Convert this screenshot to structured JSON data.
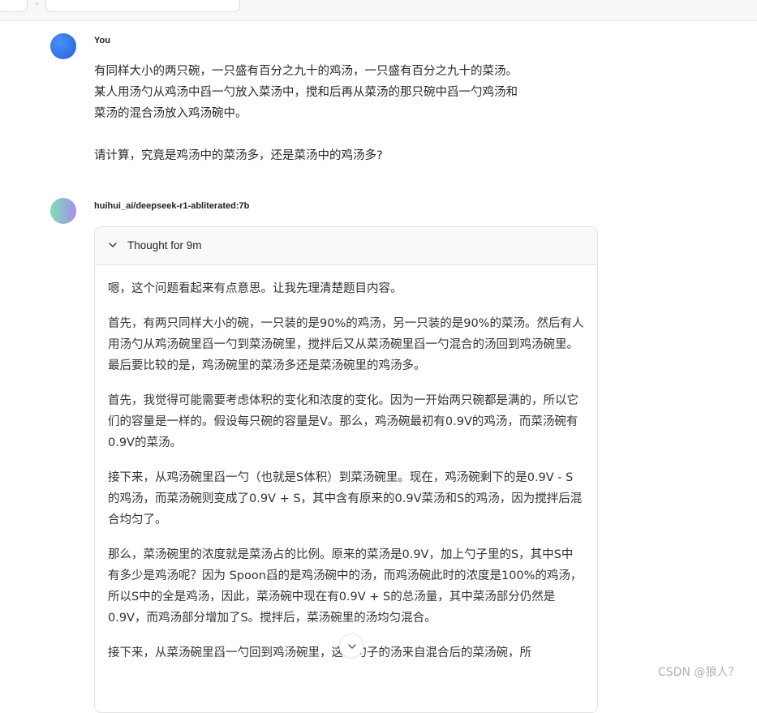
{
  "chat": {
    "user_message": {
      "author": "You",
      "paragraphs": [
        "有同样大小的两只碗，一只盛有百分之九十的鸡汤，一只盛有百分之九十的菜汤。",
        "某人用汤勺从鸡汤中舀一勺放入菜汤中，搅和后再从菜汤的那只碗中舀一勺鸡汤和",
        "菜汤的混合汤放入鸡汤碗中。",
        "请计算，究竟是鸡汤中的菜汤多，还是菜汤中的鸡汤多?"
      ]
    },
    "assistant_message": {
      "author": "huihui_ai/deepseek-r1-abliterated:7b",
      "thought_label": "Thought for 9m",
      "paragraphs": [
        "嗯，这个问题看起来有点意思。让我先理清楚题目内容。",
        "首先，有两只同样大小的碗，一只装的是90%的鸡汤，另一只装的是90%的菜汤。然后有人用汤勺从鸡汤碗里舀一勺到菜汤碗里，搅拌后又从菜汤碗里舀一勺混合的汤回到鸡汤碗里。最后要比较的是，鸡汤碗里的菜汤多还是菜汤碗里的鸡汤多。",
        "首先，我觉得可能需要考虑体积的变化和浓度的变化。因为一开始两只碗都是满的，所以它们的容量是一样的。假设每只碗的容量是V。那么，鸡汤碗最初有0.9V的鸡汤，而菜汤碗有0.9V的菜汤。",
        "接下来，从鸡汤碗里舀一勺（也就是S体积）到菜汤碗里。现在，鸡汤碗剩下的是0.9V - S的鸡汤，而菜汤碗则变成了0.9V + S，其中含有原来的0.9V菜汤和S的鸡汤，因为搅拌后混合均匀了。",
        "那么，菜汤碗里的浓度就是菜汤占的比例。原来的菜汤是0.9V，加上勺子里的S，其中S中有多少是鸡汤呢？因为 Spoon舀的是鸡汤碗中的汤，而鸡汤碗此时的浓度是100%的鸡汤，所以S中的全是鸡汤，因此，菜汤碗中现在有0.9V + S的总汤量，其中菜汤部分仍然是0.9V，而鸡汤部分增加了S。搅拌后，菜汤碗里的汤均匀混合。",
        "接下来，从菜汤碗里舀一勺回到鸡汤碗里，这一勺子的汤来自混合后的菜汤碗，所"
      ]
    }
  },
  "watermark": "CSDN @狼人？",
  "icons": {
    "collapse": "chevron-down-icon",
    "scroll": "chevron-down-icon"
  },
  "colors": {
    "user_avatar": "#3b7ff0",
    "bot_avatar_start": "#7ee0b4",
    "bot_avatar_end": "#a88cf0"
  }
}
